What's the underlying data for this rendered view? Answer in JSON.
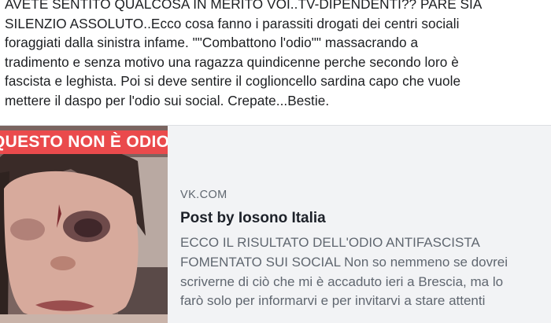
{
  "post": {
    "lines": [
      "AVETE SENTITO QUALCOSA IN MERITO VOI..TV-DIPENDENTI?? PARE SIA",
      "SILENZIO ASSOLUTO..Ecco cosa fanno i parassiti drogati dei centri sociali",
      "foraggiati dalla sinistra infame. \"\"Combattono l'odio\"\" massacrando a",
      "tradimento e senza motivo una ragazza quindicenne perche secondo loro è",
      "fascista e leghista. Poi si deve sentire il coglioncello sardina capo che vuole",
      "mettere il daspo per l'odio sui social. Crepate...Bestie."
    ]
  },
  "link_card": {
    "image_banner": "QUESTO NON È ODIO",
    "domain": "VK.COM",
    "title": "Post by Iosono Italia",
    "description_lines": [
      "ECCO IL RISULTATO DELL'ODIO ANTIFASCISTA",
      "FOMENTATO SUI SOCIAL Non so nemmeno se dovrei",
      "scriverne di ciò che mi è accaduto ieri a Brescia, ma lo",
      "farò solo per informarvi e per invitarvi a stare attenti"
    ]
  },
  "colors": {
    "text": "#1c1e21",
    "card_background": "#f2f3f5",
    "muted_text": "#606770",
    "banner_red": "#ea4a4c"
  }
}
